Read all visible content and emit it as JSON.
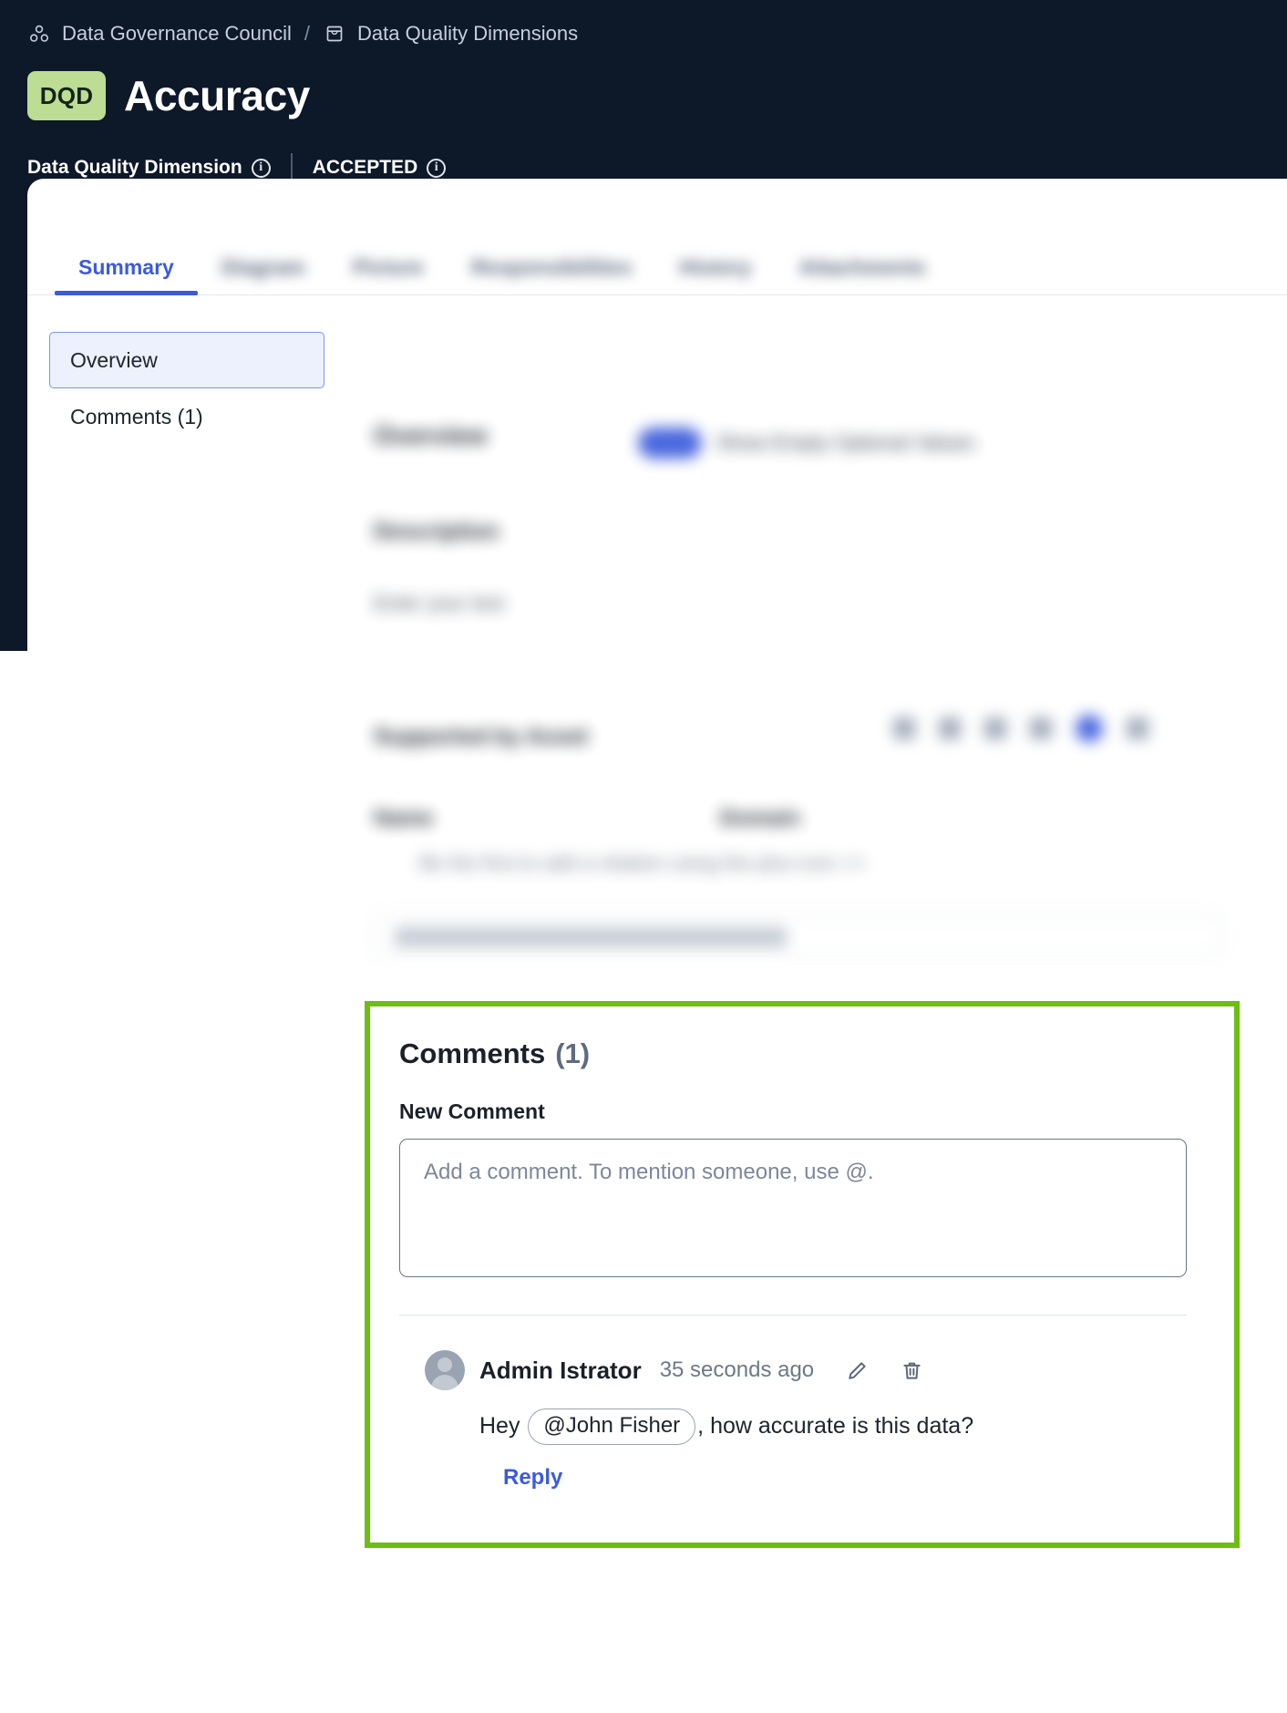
{
  "header": {
    "breadcrumb": [
      {
        "icon": "community-icon",
        "label": "Data Governance Council"
      },
      {
        "icon": "domain-icon",
        "label": "Data Quality Dimensions"
      }
    ],
    "separator": "/",
    "badge": "DQD",
    "title": "Accuracy",
    "asset_type": "Data Quality Dimension",
    "status": "ACCEPTED",
    "info_icon": "info-icon",
    "background_color": "#0d1829",
    "badge_color": "#bcdd93"
  },
  "tabs": [
    {
      "label": "Summary",
      "active": true,
      "blurred": false
    },
    {
      "label": "Diagram",
      "active": false,
      "blurred": true
    },
    {
      "label": "Picture",
      "active": false,
      "blurred": true
    },
    {
      "label": "Responsibilities",
      "active": false,
      "blurred": true
    },
    {
      "label": "History",
      "active": false,
      "blurred": true
    },
    {
      "label": "Attachments",
      "active": false,
      "blurred": true
    }
  ],
  "side_nav": {
    "items": [
      {
        "label": "Overview",
        "active": true
      },
      {
        "label": "Comments (1)",
        "active": false
      }
    ]
  },
  "overview_section": {
    "heading": "Overview",
    "toggle_label": "Show Empty Optional Values",
    "toggle_on": true,
    "description_label": "Description",
    "description_value": "Enter your text",
    "supported_by_label": "Supported by Asset",
    "table_headers": [
      "Name",
      "Domain"
    ],
    "empty_state": "Be the first to add a relation using the plus icon >>",
    "search_value": ""
  },
  "comments": {
    "title": "Comments",
    "count": "(1)",
    "new_comment_label": "New Comment",
    "placeholder": "Add a comment. To mention someone, use @.",
    "input_value": "",
    "highlight_color": "#6dbe10",
    "items": [
      {
        "avatar": "user-avatar",
        "author": "Admin Istrator",
        "timestamp": "35 seconds ago",
        "edit_icon": "pencil-icon",
        "delete_icon": "trash-icon",
        "text_before": "Hey ",
        "mention": "@John Fisher",
        "text_after": ", how accurate is this data?",
        "reply_label": "Reply"
      }
    ]
  }
}
